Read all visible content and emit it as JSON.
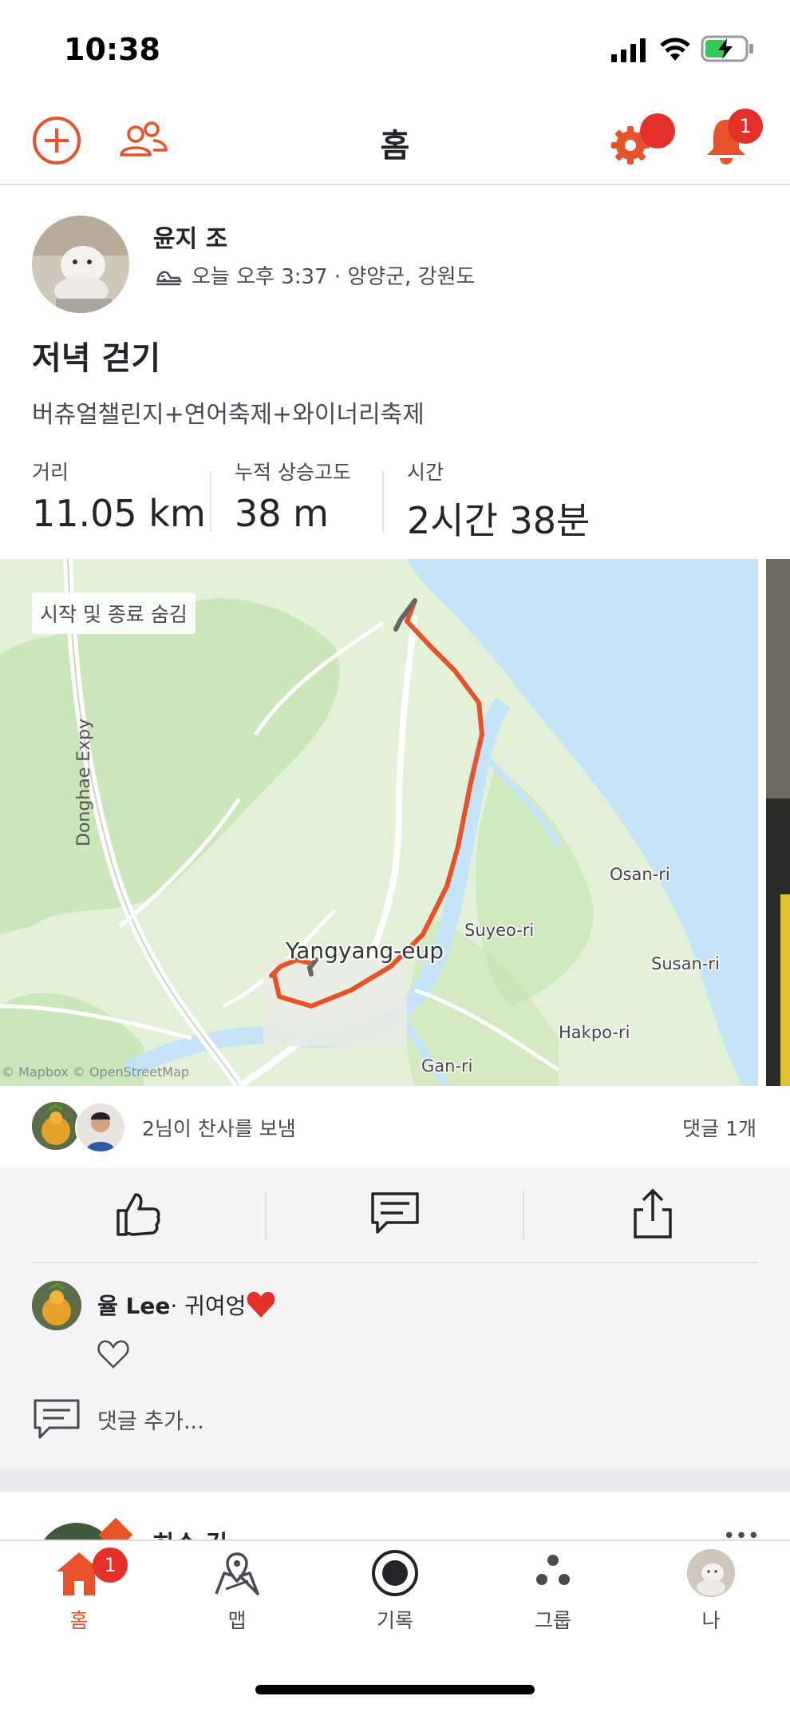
{
  "status_bar": {
    "time": "10:38"
  },
  "header": {
    "title": "홈",
    "notification_count": "1"
  },
  "activity": {
    "athlete_name": "윤지 조",
    "meta": "오늘 오후 3:37 · 양양군, 강원도",
    "title": "저녁 걷기",
    "description": "버츄얼챌린지+연어축제+와이너리축제",
    "stats": [
      {
        "label": "거리",
        "value": "11.05 km"
      },
      {
        "label": "누적 상승고도",
        "value": "38 m"
      },
      {
        "label": "시간",
        "value": "2시간 38분"
      }
    ],
    "map": {
      "hide_start_end": "시작 및 종료 숨김",
      "labels": {
        "expressway": "Donghae Expy",
        "town": "Yangyang-eup",
        "osan": "Osan-ri",
        "suyeo": "Suyeo-ri",
        "susan": "Susan-ri",
        "hakpo": "Hakpo-ri",
        "gan": "Gan-ri",
        "attribution": "© Mapbox © OpenStreetMap"
      },
      "colors": {
        "land": "#e3f1d8",
        "water": "#c4e3f7",
        "route": "#e8522a"
      }
    },
    "kudos_text": "2님이 찬사를 보냄",
    "comment_count": "댓글 1개",
    "comment": {
      "author": "율 Lee",
      "text": " · 귀여엉"
    },
    "add_comment_placeholder": "댓글 추가..."
  },
  "next_card": {
    "athlete_name": "하수 김"
  },
  "tabbar": {
    "tabs": [
      {
        "label": "홈",
        "icon": "home-icon",
        "active": true
      },
      {
        "label": "맵",
        "icon": "map-icon"
      },
      {
        "label": "기록",
        "icon": "record-icon"
      },
      {
        "label": "그룹",
        "icon": "groups-icon"
      },
      {
        "label": "나",
        "icon": "profile-avatar"
      }
    ],
    "home_badge": "1"
  },
  "colors": {
    "accent": "#e8522a",
    "badge": "#e5302a",
    "text": "#242428",
    "muted": "#4a4a50"
  }
}
